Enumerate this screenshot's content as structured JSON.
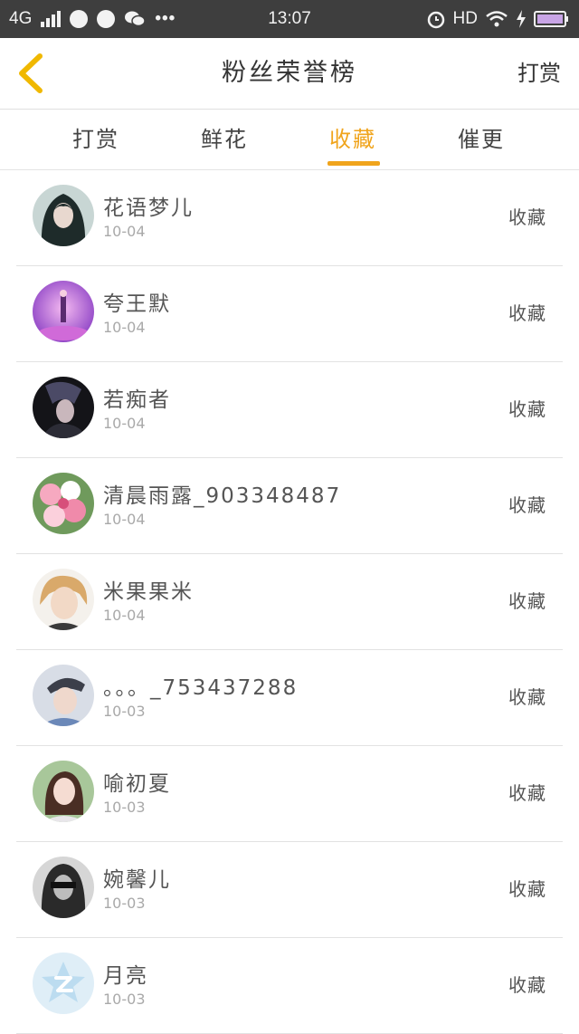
{
  "status_bar": {
    "network": "4G",
    "time": "13:07",
    "hd": "HD",
    "dots": "•••"
  },
  "nav": {
    "title": "粉丝荣誉榜",
    "right_label": "打赏"
  },
  "tabs": [
    {
      "label": "打赏",
      "active": false
    },
    {
      "label": "鲜花",
      "active": false
    },
    {
      "label": "收藏",
      "active": true
    },
    {
      "label": "催更",
      "active": false
    }
  ],
  "colors": {
    "accent": "#f0a41c",
    "status_bar": "#3e3e3e",
    "back_arrow": "#f0b800"
  },
  "rows": [
    {
      "name": "花语梦儿",
      "date": "10-04",
      "action": "收藏",
      "avatar_icon": "avatar-dark-hair"
    },
    {
      "name": "夸王默",
      "date": "10-04",
      "action": "收藏",
      "avatar_icon": "avatar-purple-stage"
    },
    {
      "name": "若痴者",
      "date": "10-04",
      "action": "收藏",
      "avatar_icon": "avatar-dark-portrait"
    },
    {
      "name": "清晨雨露_903348487",
      "date": "10-04",
      "action": "收藏",
      "avatar_icon": "avatar-flowers"
    },
    {
      "name": "米果果米",
      "date": "10-04",
      "action": "收藏",
      "avatar_icon": "avatar-blond-boy"
    },
    {
      "name": "。。。_753437288",
      "date": "10-03",
      "action": "收藏",
      "avatar_icon": "avatar-cap-boy"
    },
    {
      "name": "喻初夏",
      "date": "10-03",
      "action": "收藏",
      "avatar_icon": "avatar-girl"
    },
    {
      "name": "婉馨儿",
      "date": "10-03",
      "action": "收藏",
      "avatar_icon": "avatar-bw-portrait"
    },
    {
      "name": "月亮",
      "date": "10-03",
      "action": "收藏",
      "avatar_icon": "avatar-default-qzone"
    }
  ]
}
